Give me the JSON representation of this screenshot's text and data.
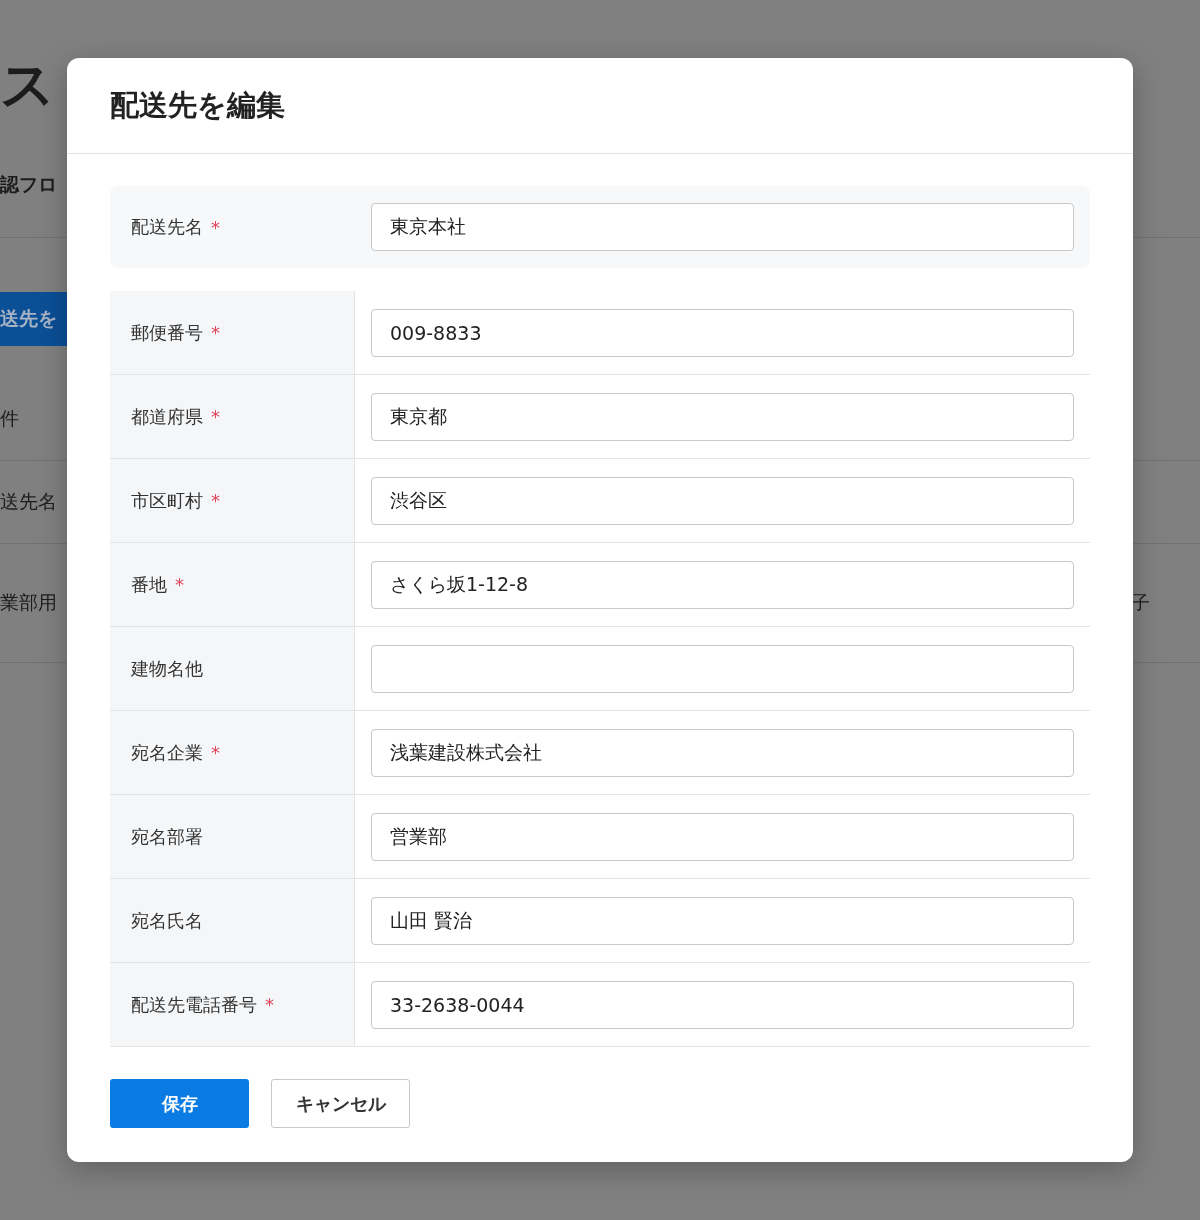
{
  "background": {
    "heading": "ス",
    "subtitle": "認フロ",
    "button": "送先を",
    "rows": [
      {
        "left": "件"
      },
      {
        "left": "送先名"
      },
      {
        "left": "業部用",
        "right": "子"
      }
    ]
  },
  "dialog": {
    "title": "配送先を編集",
    "fields": [
      {
        "label": "配送先名",
        "required_mark": "*",
        "value": "東京本社",
        "highlighted": true
      },
      {
        "label": "郵便番号",
        "required_mark": "*",
        "value": "009-8833",
        "highlighted": false
      },
      {
        "label": "都道府県",
        "required_mark": "*",
        "value": "東京都",
        "highlighted": false
      },
      {
        "label": "市区町村",
        "required_mark": "*",
        "value": "渋谷区",
        "highlighted": false
      },
      {
        "label": "番地",
        "required_mark": "*",
        "value": "さくら坂1-12-8",
        "highlighted": false
      },
      {
        "label": "建物名他",
        "highlighted": false
      },
      {
        "label": "宛名企業",
        "required_mark": "*",
        "value": "浅葉建設株式会社",
        "highlighted": false
      },
      {
        "label": "宛名部署",
        "value": "営業部",
        "highlighted": false
      },
      {
        "label": "宛名氏名",
        "value": "山田 賢治",
        "highlighted": false
      },
      {
        "label": "配送先電話番号",
        "required_mark": "*",
        "value": "33-2638-0044",
        "highlighted": false
      }
    ],
    "buttons": [
      {
        "label": "保存",
        "kind": "primary"
      },
      {
        "label": "キャンセル",
        "kind": "secondary"
      }
    ]
  }
}
